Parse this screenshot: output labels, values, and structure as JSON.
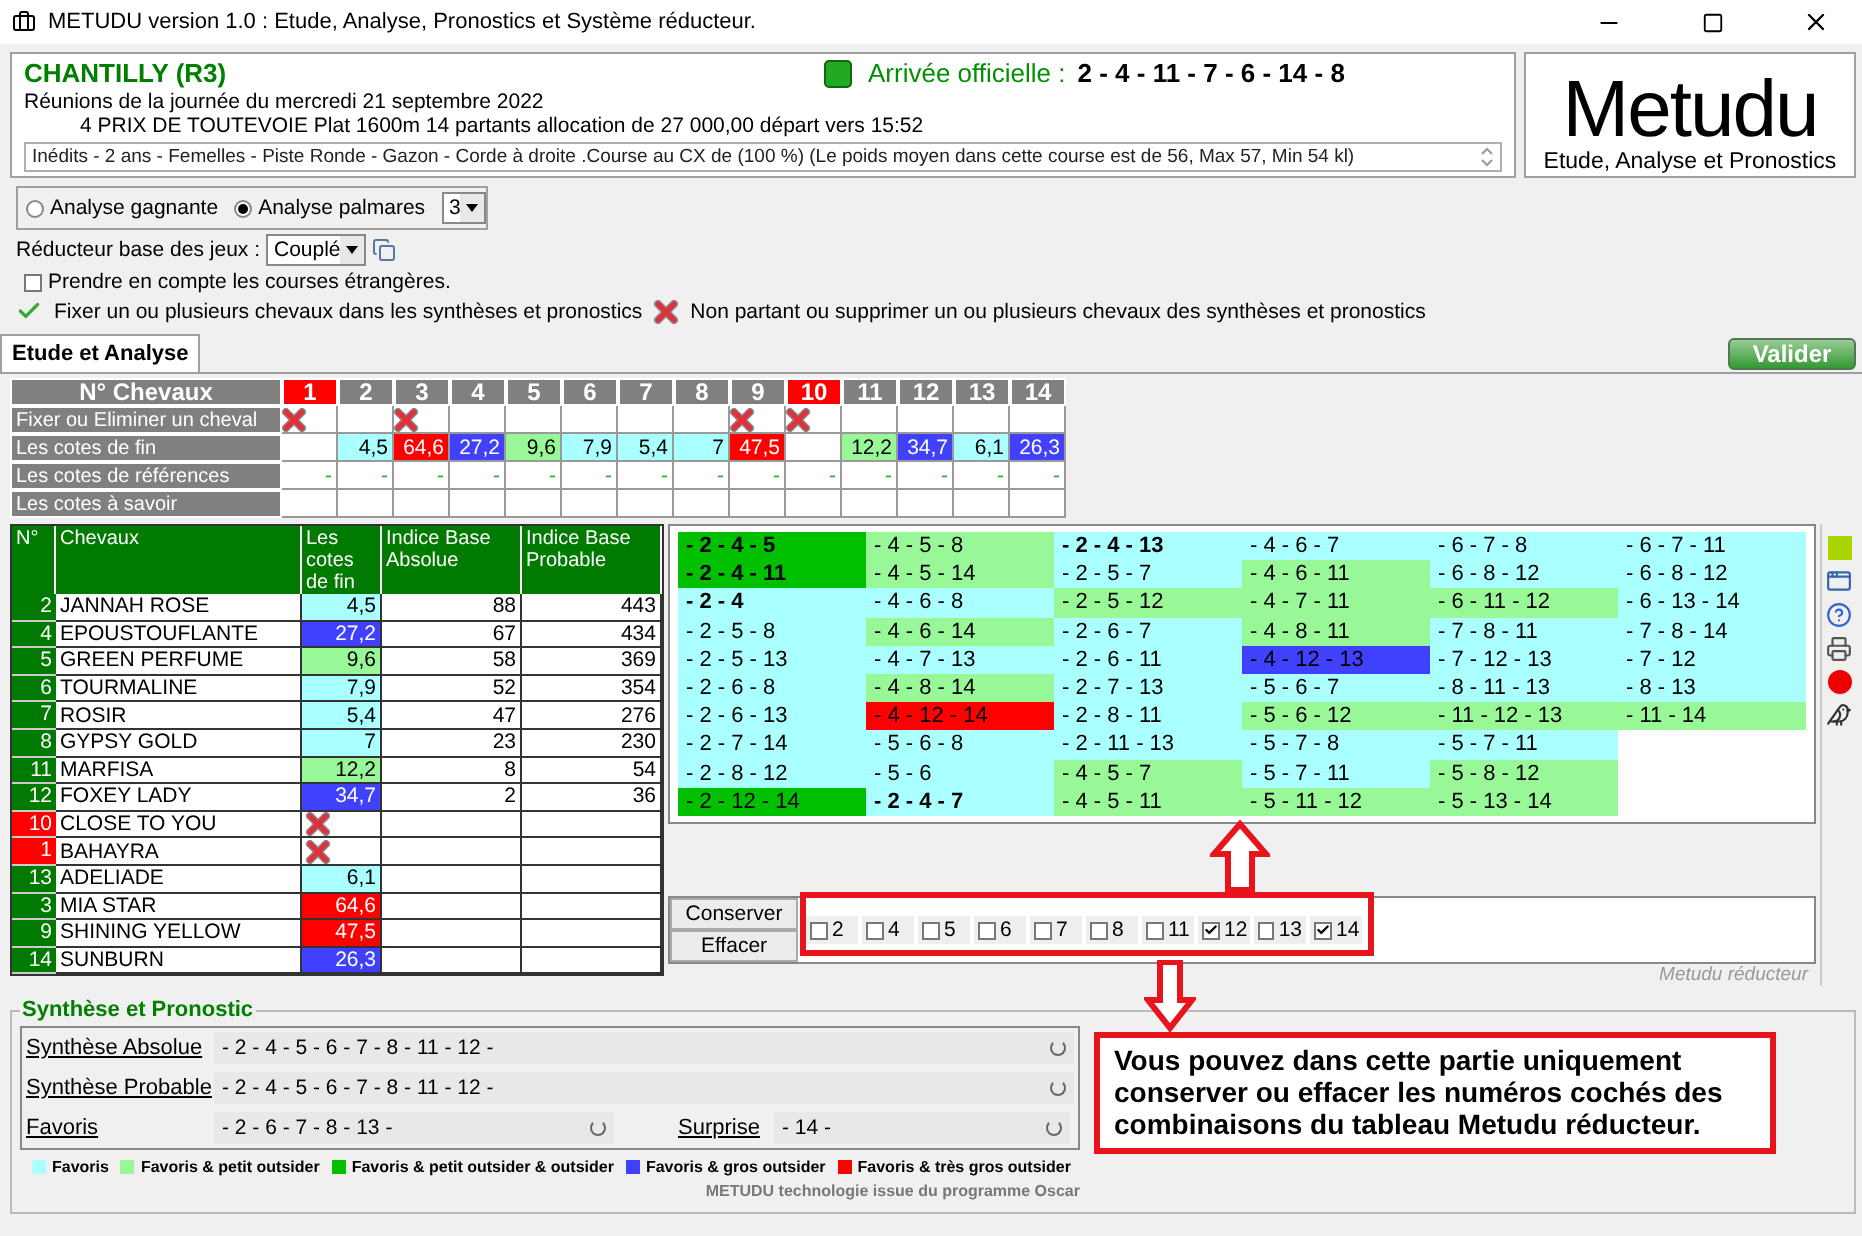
{
  "window": {
    "title": "METUDU version 1.0  : Etude, Analyse,  Pronostics et Système réducteur."
  },
  "race": {
    "name": "CHANTILLY (R3)",
    "arrival_label": "Arrivée officielle :",
    "arrival": "2 - 4 - 11 - 7 - 6 - 14 - 8",
    "date_line": "Réunions de la journée du mercredi 21 septembre 2022",
    "race_line": "4 PRIX DE TOUTEVOIE Plat 1600m 14 partants allocation de 27 000,00 départ vers 15:52",
    "conditions": "Inédits - 2 ans - Femelles - Piste Ronde - Gazon - Corde à droite .Course au CX de (100 %)  (Le poids moyen dans cette course est de 56, Max 57, Min 54 kl)"
  },
  "logo": {
    "title": "Metudu",
    "subtitle": "Etude, Analyse et Pronostics"
  },
  "analysis_options": [
    {
      "label": "Analyse gagnante",
      "selected": false
    },
    {
      "label": "Analyse palmares",
      "selected": true
    }
  ],
  "palmares_count": "3",
  "reducer": {
    "label": "Réducteur base des jeux :",
    "value": "Couplé"
  },
  "foreign_races": {
    "label": "Prendre en compte les courses étrangères.",
    "checked": false
  },
  "hints": {
    "fix": "Fixer un ou plusieurs chevaux dans les synthèses et pronostics",
    "remove": "Non partant ou supprimer un ou plusieurs chevaux des synthèses et pronostics"
  },
  "tabs": [
    {
      "label": "Etude et Analyse",
      "selected": true
    }
  ],
  "validate_button": "Valider",
  "grid": {
    "header": "N° Chevaux",
    "row_labels": [
      "Fixer ou Eliminer un cheval",
      "Les cotes de fin",
      "Les cotes de références",
      "Les cotes à savoir"
    ],
    "horses": [
      {
        "number": "1",
        "non_partant": true,
        "eliminated": true,
        "color": "#ffffff",
        "reference": "-"
      },
      {
        "number": "2",
        "non_partant": false,
        "eliminated": false,
        "cote": "4,5",
        "color": "#aaffff",
        "reference": "-"
      },
      {
        "number": "3",
        "non_partant": false,
        "eliminated": true,
        "cote": "64,6",
        "color": "#ff0000",
        "reference": "-"
      },
      {
        "number": "4",
        "non_partant": false,
        "eliminated": false,
        "cote": "27,2",
        "color": "#4040ff",
        "reference": "-"
      },
      {
        "number": "5",
        "non_partant": false,
        "eliminated": false,
        "cote": "9,6",
        "color": "#98f898",
        "reference": "-"
      },
      {
        "number": "6",
        "non_partant": false,
        "eliminated": false,
        "cote": "7,9",
        "color": "#aaffff",
        "reference": "-"
      },
      {
        "number": "7",
        "non_partant": false,
        "eliminated": false,
        "cote": "5,4",
        "color": "#aaffff",
        "reference": "-"
      },
      {
        "number": "8",
        "non_partant": false,
        "eliminated": false,
        "cote": "7",
        "color": "#aaffff",
        "reference": "-"
      },
      {
        "number": "9",
        "non_partant": false,
        "eliminated": true,
        "cote": "47,5",
        "color": "#ff0000",
        "reference": "-"
      },
      {
        "number": "10",
        "non_partant": true,
        "eliminated": true,
        "color": "#ffffff",
        "reference": "-"
      },
      {
        "number": "11",
        "non_partant": false,
        "eliminated": false,
        "cote": "12,2",
        "color": "#98f898",
        "reference": "-"
      },
      {
        "number": "12",
        "non_partant": false,
        "eliminated": false,
        "cote": "34,7",
        "color": "#4040ff",
        "reference": "-"
      },
      {
        "number": "13",
        "non_partant": false,
        "eliminated": false,
        "cote": "6,1",
        "color": "#aaffff",
        "reference": "-"
      },
      {
        "number": "14",
        "non_partant": false,
        "eliminated": false,
        "cote": "26,3",
        "color": "#4040ff",
        "reference": "-"
      }
    ]
  },
  "table": {
    "columns": [
      "N°",
      "Chevaux",
      "Les cotes de fin",
      "Indice Base Absolue",
      "Indice Base Probable"
    ],
    "rows": [
      {
        "number": "2",
        "non_partant": false,
        "name": "JANNAH ROSE",
        "eliminated": false,
        "cote": "4,5",
        "color": "#aaffff",
        "absolue": "88",
        "probable": "443"
      },
      {
        "number": "4",
        "non_partant": false,
        "name": "EPOUSTOUFLANTE",
        "eliminated": false,
        "cote": "27,2",
        "color": "#4040ff",
        "absolue": "67",
        "probable": "434"
      },
      {
        "number": "5",
        "non_partant": false,
        "name": "GREEN PERFUME",
        "eliminated": false,
        "cote": "9,6",
        "color": "#98f898",
        "absolue": "58",
        "probable": "369"
      },
      {
        "number": "6",
        "non_partant": false,
        "name": "TOURMALINE",
        "eliminated": false,
        "cote": "7,9",
        "color": "#aaffff",
        "absolue": "52",
        "probable": "354"
      },
      {
        "number": "7",
        "non_partant": false,
        "name": "ROSIR",
        "eliminated": false,
        "cote": "5,4",
        "color": "#aaffff",
        "absolue": "47",
        "probable": "276"
      },
      {
        "number": "8",
        "non_partant": false,
        "name": "GYPSY GOLD",
        "eliminated": false,
        "cote": "7",
        "color": "#aaffff",
        "absolue": "23",
        "probable": "230"
      },
      {
        "number": "11",
        "non_partant": false,
        "name": "MARFISA",
        "eliminated": false,
        "cote": "12,2",
        "color": "#98f898",
        "absolue": "8",
        "probable": "54"
      },
      {
        "number": "12",
        "non_partant": false,
        "name": "FOXEY LADY",
        "eliminated": false,
        "cote": "34,7",
        "color": "#4040ff",
        "absolue": "2",
        "probable": "36"
      },
      {
        "number": "10",
        "non_partant": true,
        "name": "CLOSE TO YOU",
        "eliminated": true,
        "color": "#ffffff"
      },
      {
        "number": "1",
        "non_partant": true,
        "name": "BAHAYRA",
        "eliminated": true,
        "color": "#ffffff"
      },
      {
        "number": "13",
        "non_partant": false,
        "name": "ADELIADE",
        "eliminated": false,
        "cote": "6,1",
        "color": "#aaffff"
      },
      {
        "number": "3",
        "non_partant": false,
        "name": "MIA STAR",
        "eliminated": false,
        "cote": "64,6",
        "color": "#ff0000"
      },
      {
        "number": "9",
        "non_partant": false,
        "name": "SHINING YELLOW",
        "eliminated": false,
        "cote": "47,5",
        "color": "#ff0000"
      },
      {
        "number": "14",
        "non_partant": false,
        "name": "SUNBURN",
        "eliminated": false,
        "cote": "26,3",
        "color": "#4040ff"
      }
    ]
  },
  "combinations": [
    {
      "text": "- 2 - 4 - 5",
      "color": "#00c000",
      "bold": true
    },
    {
      "text": "- 2 - 4 - 11",
      "color": "#00c000",
      "bold": true
    },
    {
      "text": "- 2 - 4",
      "color": "#aaffff",
      "bold": true
    },
    {
      "text": "- 2 - 5 - 8",
      "color": "#aaffff",
      "bold": false
    },
    {
      "text": "- 2 - 5 - 13",
      "color": "#aaffff",
      "bold": false
    },
    {
      "text": "- 2 - 6 - 8",
      "color": "#aaffff",
      "bold": false
    },
    {
      "text": "- 2 - 6 - 13",
      "color": "#aaffff",
      "bold": false
    },
    {
      "text": "- 2 - 7 - 14",
      "color": "#aaffff",
      "bold": false
    },
    {
      "text": "- 2 - 8 - 12",
      "color": "#aaffff",
      "bold": false
    },
    {
      "text": "- 2 - 12 - 14",
      "color": "#00c000",
      "bold": false
    },
    {
      "text": "- 4 - 5 - 8",
      "color": "#98f898",
      "bold": false
    },
    {
      "text": "- 4 - 5 - 14",
      "color": "#98f898",
      "bold": false
    },
    {
      "text": "- 4 - 6 - 8",
      "color": "#aaffff",
      "bold": false
    },
    {
      "text": "- 4 - 6 - 14",
      "color": "#98f898",
      "bold": false
    },
    {
      "text": "- 4 - 7 - 13",
      "color": "#aaffff",
      "bold": false
    },
    {
      "text": "- 4 - 8 - 14",
      "color": "#98f898",
      "bold": false
    },
    {
      "text": "- 4 - 12 - 14",
      "color": "#ff0000",
      "bold": false
    },
    {
      "text": "- 5 - 6 - 8",
      "color": "#aaffff",
      "bold": false
    },
    {
      "text": "- 5 - 6",
      "color": "#aaffff",
      "bold": false
    },
    {
      "text": "- 2 - 4 - 7",
      "color": "#aaffff",
      "bold": true
    },
    {
      "text": "- 2 - 4 - 13",
      "color": "#aaffff",
      "bold": true
    },
    {
      "text": "- 2 - 5 - 7",
      "color": "#aaffff",
      "bold": false
    },
    {
      "text": "- 2 - 5 - 12",
      "color": "#98f898",
      "bold": false
    },
    {
      "text": "- 2 - 6 - 7",
      "color": "#aaffff",
      "bold": false
    },
    {
      "text": "- 2 - 6 - 11",
      "color": "#aaffff",
      "bold": false
    },
    {
      "text": "- 2 - 7 - 13",
      "color": "#aaffff",
      "bold": false
    },
    {
      "text": "- 2 - 8 - 11",
      "color": "#aaffff",
      "bold": false
    },
    {
      "text": "- 2 - 11 - 13",
      "color": "#aaffff",
      "bold": false
    },
    {
      "text": "- 4 - 5 - 7",
      "color": "#98f898",
      "bold": false
    },
    {
      "text": "- 4 - 5 - 11",
      "color": "#98f898",
      "bold": false
    },
    {
      "text": "- 4 - 6 - 7",
      "color": "#aaffff",
      "bold": false
    },
    {
      "text": "- 4 - 6 - 11",
      "color": "#98f898",
      "bold": false
    },
    {
      "text": "- 4 - 7 - 11",
      "color": "#98f898",
      "bold": false
    },
    {
      "text": "- 4 - 8 - 11",
      "color": "#98f898",
      "bold": false
    },
    {
      "text": "- 4 - 12 - 13",
      "color": "#4040ff",
      "bold": false
    },
    {
      "text": "- 5 - 6 - 7",
      "color": "#aaffff",
      "bold": false
    },
    {
      "text": "- 5 - 6 - 12",
      "color": "#98f898",
      "bold": false
    },
    {
      "text": "- 5 - 7 - 8",
      "color": "#aaffff",
      "bold": false
    },
    {
      "text": "- 5 - 7 - 11",
      "color": "#aaffff",
      "bold": false
    },
    {
      "text": "- 5 - 11 - 12",
      "color": "#98f898",
      "bold": false
    },
    {
      "text": "- 6 - 7 - 8",
      "color": "#aaffff",
      "bold": false
    },
    {
      "text": "- 6 - 8 - 12",
      "color": "#aaffff",
      "bold": false
    },
    {
      "text": "- 6 - 11 - 12",
      "color": "#98f898",
      "bold": false
    },
    {
      "text": "- 7 - 8 - 11",
      "color": "#aaffff",
      "bold": false
    },
    {
      "text": "- 7 - 12 - 13",
      "color": "#aaffff",
      "bold": false
    },
    {
      "text": "- 8 - 11 - 13",
      "color": "#aaffff",
      "bold": false
    },
    {
      "text": "- 11 - 12 - 13",
      "color": "#98f898",
      "bold": false
    },
    {
      "text": "- 5 - 7 - 11",
      "color": "#aaffff",
      "bold": false
    },
    {
      "text": "- 5 - 8 - 12",
      "color": "#98f898",
      "bold": false
    },
    {
      "text": "- 5 - 13 - 14",
      "color": "#98f898",
      "bold": false
    },
    {
      "text": "- 6 - 7 - 11",
      "color": "#aaffff",
      "bold": false
    },
    {
      "text": "- 6 - 8 - 12",
      "color": "#aaffff",
      "bold": false
    },
    {
      "text": "- 6 - 13 - 14",
      "color": "#aaffff",
      "bold": false
    },
    {
      "text": "- 7 - 8 - 14",
      "color": "#aaffff",
      "bold": false
    },
    {
      "text": "- 7 - 12",
      "color": "#aaffff",
      "bold": false
    },
    {
      "text": "- 8 - 13",
      "color": "#aaffff",
      "bold": false
    },
    {
      "text": "- 11 - 14",
      "color": "#98f898",
      "bold": false
    }
  ],
  "reducer_buttons": [
    "Conserver",
    "Effacer"
  ],
  "number_checks": [
    {
      "label": "2",
      "checked": false
    },
    {
      "label": "4",
      "checked": false
    },
    {
      "label": "5",
      "checked": false
    },
    {
      "label": "6",
      "checked": false
    },
    {
      "label": "7",
      "checked": false
    },
    {
      "label": "8",
      "checked": false
    },
    {
      "label": "11",
      "checked": false
    },
    {
      "label": "12",
      "checked": true
    },
    {
      "label": "13",
      "checked": false
    },
    {
      "label": "14",
      "checked": true
    }
  ],
  "reducer_caption": "Metudu réducteur",
  "synthesis": {
    "title": "Synthèse et Pronostic",
    "rows": [
      {
        "label": "Synthèse Absolue",
        "value": "- 2 - 4 - 5 - 6 - 7 - 8 - 11 - 12 -"
      },
      {
        "label": "Synthèse Probable",
        "value": "- 2 - 4 - 5 - 6 - 7 - 8 - 11 - 12 -"
      }
    ],
    "favoris": {
      "label": "Favoris",
      "value": "- 2 - 6 - 7 - 8 - 13 -"
    },
    "surprise": {
      "label": "Surprise",
      "value": "- 14 -"
    },
    "legend": [
      {
        "label": "Favoris",
        "color": "#aaffff"
      },
      {
        "label": "Favoris & petit outsider",
        "color": "#98f898"
      },
      {
        "label": "Favoris & petit outsider & outsider",
        "color": "#00c000"
      },
      {
        "label": "Favoris & gros outsider",
        "color": "#4040ff"
      },
      {
        "label": "Favoris & très gros outsider",
        "color": "#ff0000"
      }
    ],
    "credit": "METUDU technologie issue du programme Oscar"
  },
  "annotation": "Vous pouvez dans cette partie uniquement conserver ou effacer les numéros cochés des combinaisons du tableau Metudu réducteur."
}
